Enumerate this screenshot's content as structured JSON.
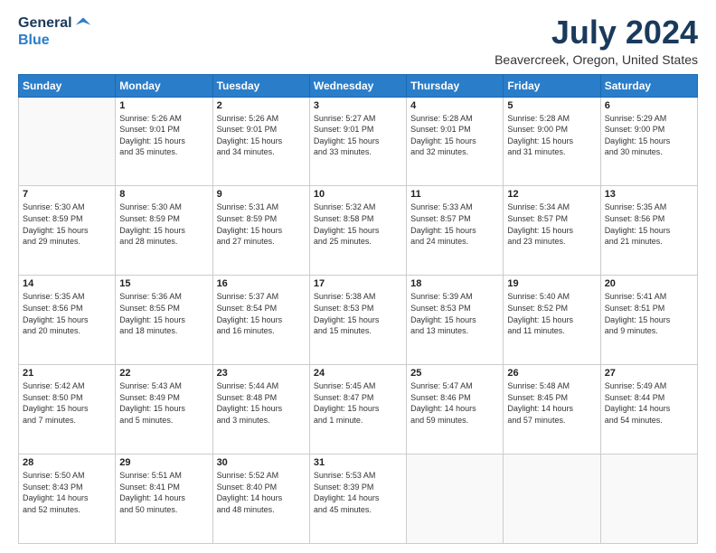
{
  "logo": {
    "general": "General",
    "blue": "Blue"
  },
  "header": {
    "month": "July 2024",
    "location": "Beavercreek, Oregon, United States"
  },
  "weekdays": [
    "Sunday",
    "Monday",
    "Tuesday",
    "Wednesday",
    "Thursday",
    "Friday",
    "Saturday"
  ],
  "weeks": [
    [
      {
        "day": "",
        "info": ""
      },
      {
        "day": "1",
        "info": "Sunrise: 5:26 AM\nSunset: 9:01 PM\nDaylight: 15 hours\nand 35 minutes."
      },
      {
        "day": "2",
        "info": "Sunrise: 5:26 AM\nSunset: 9:01 PM\nDaylight: 15 hours\nand 34 minutes."
      },
      {
        "day": "3",
        "info": "Sunrise: 5:27 AM\nSunset: 9:01 PM\nDaylight: 15 hours\nand 33 minutes."
      },
      {
        "day": "4",
        "info": "Sunrise: 5:28 AM\nSunset: 9:01 PM\nDaylight: 15 hours\nand 32 minutes."
      },
      {
        "day": "5",
        "info": "Sunrise: 5:28 AM\nSunset: 9:00 PM\nDaylight: 15 hours\nand 31 minutes."
      },
      {
        "day": "6",
        "info": "Sunrise: 5:29 AM\nSunset: 9:00 PM\nDaylight: 15 hours\nand 30 minutes."
      }
    ],
    [
      {
        "day": "7",
        "info": "Sunrise: 5:30 AM\nSunset: 8:59 PM\nDaylight: 15 hours\nand 29 minutes."
      },
      {
        "day": "8",
        "info": "Sunrise: 5:30 AM\nSunset: 8:59 PM\nDaylight: 15 hours\nand 28 minutes."
      },
      {
        "day": "9",
        "info": "Sunrise: 5:31 AM\nSunset: 8:59 PM\nDaylight: 15 hours\nand 27 minutes."
      },
      {
        "day": "10",
        "info": "Sunrise: 5:32 AM\nSunset: 8:58 PM\nDaylight: 15 hours\nand 25 minutes."
      },
      {
        "day": "11",
        "info": "Sunrise: 5:33 AM\nSunset: 8:57 PM\nDaylight: 15 hours\nand 24 minutes."
      },
      {
        "day": "12",
        "info": "Sunrise: 5:34 AM\nSunset: 8:57 PM\nDaylight: 15 hours\nand 23 minutes."
      },
      {
        "day": "13",
        "info": "Sunrise: 5:35 AM\nSunset: 8:56 PM\nDaylight: 15 hours\nand 21 minutes."
      }
    ],
    [
      {
        "day": "14",
        "info": "Sunrise: 5:35 AM\nSunset: 8:56 PM\nDaylight: 15 hours\nand 20 minutes."
      },
      {
        "day": "15",
        "info": "Sunrise: 5:36 AM\nSunset: 8:55 PM\nDaylight: 15 hours\nand 18 minutes."
      },
      {
        "day": "16",
        "info": "Sunrise: 5:37 AM\nSunset: 8:54 PM\nDaylight: 15 hours\nand 16 minutes."
      },
      {
        "day": "17",
        "info": "Sunrise: 5:38 AM\nSunset: 8:53 PM\nDaylight: 15 hours\nand 15 minutes."
      },
      {
        "day": "18",
        "info": "Sunrise: 5:39 AM\nSunset: 8:53 PM\nDaylight: 15 hours\nand 13 minutes."
      },
      {
        "day": "19",
        "info": "Sunrise: 5:40 AM\nSunset: 8:52 PM\nDaylight: 15 hours\nand 11 minutes."
      },
      {
        "day": "20",
        "info": "Sunrise: 5:41 AM\nSunset: 8:51 PM\nDaylight: 15 hours\nand 9 minutes."
      }
    ],
    [
      {
        "day": "21",
        "info": "Sunrise: 5:42 AM\nSunset: 8:50 PM\nDaylight: 15 hours\nand 7 minutes."
      },
      {
        "day": "22",
        "info": "Sunrise: 5:43 AM\nSunset: 8:49 PM\nDaylight: 15 hours\nand 5 minutes."
      },
      {
        "day": "23",
        "info": "Sunrise: 5:44 AM\nSunset: 8:48 PM\nDaylight: 15 hours\nand 3 minutes."
      },
      {
        "day": "24",
        "info": "Sunrise: 5:45 AM\nSunset: 8:47 PM\nDaylight: 15 hours\nand 1 minute."
      },
      {
        "day": "25",
        "info": "Sunrise: 5:47 AM\nSunset: 8:46 PM\nDaylight: 14 hours\nand 59 minutes."
      },
      {
        "day": "26",
        "info": "Sunrise: 5:48 AM\nSunset: 8:45 PM\nDaylight: 14 hours\nand 57 minutes."
      },
      {
        "day": "27",
        "info": "Sunrise: 5:49 AM\nSunset: 8:44 PM\nDaylight: 14 hours\nand 54 minutes."
      }
    ],
    [
      {
        "day": "28",
        "info": "Sunrise: 5:50 AM\nSunset: 8:43 PM\nDaylight: 14 hours\nand 52 minutes."
      },
      {
        "day": "29",
        "info": "Sunrise: 5:51 AM\nSunset: 8:41 PM\nDaylight: 14 hours\nand 50 minutes."
      },
      {
        "day": "30",
        "info": "Sunrise: 5:52 AM\nSunset: 8:40 PM\nDaylight: 14 hours\nand 48 minutes."
      },
      {
        "day": "31",
        "info": "Sunrise: 5:53 AM\nSunset: 8:39 PM\nDaylight: 14 hours\nand 45 minutes."
      },
      {
        "day": "",
        "info": ""
      },
      {
        "day": "",
        "info": ""
      },
      {
        "day": "",
        "info": ""
      }
    ]
  ]
}
